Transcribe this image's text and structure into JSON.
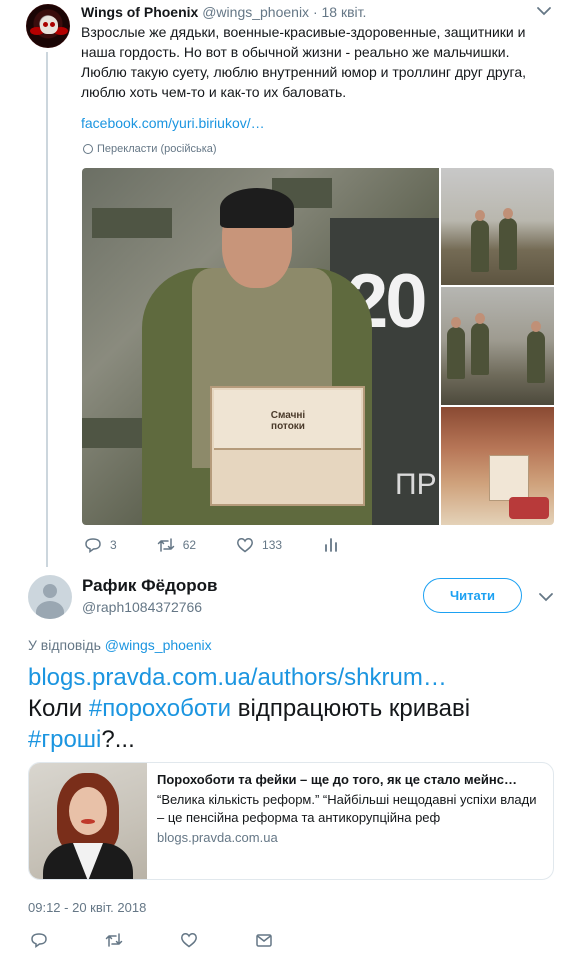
{
  "parent_tweet": {
    "author_name": "Wings of Phoenix",
    "author_handle": "@wings_phoenix",
    "separator": "·",
    "date": "18 квіт.",
    "text": "Взрослые же дядьки, военные-красивые-здоровенные, защитники и наша гордость. Но вот в обычной жизни - реально же мальчишки. Люблю такую суету, люблю внутренний юмор и троллинг друг друга, люблю хоть чем-то и как-то их баловать.",
    "link": "facebook.com/yuri.biriukov/…",
    "translate_label": "Перекласти (російська)",
    "media": {
      "banner_number": "20",
      "banner_letters": "ПР",
      "box_brand": "Смачні потоки"
    },
    "actions": {
      "reply_icon": "reply-icon",
      "reply_count": "3",
      "retweet_icon": "retweet-icon",
      "retweet_count": "62",
      "like_icon": "heart-icon",
      "like_count": "133",
      "analytics_icon": "analytics-icon"
    }
  },
  "focused_tweet": {
    "author_name": "Рафик Фёдоров",
    "author_handle": "@raph1084372766",
    "follow_label": "Читати",
    "reply_prefix": "У відповідь ",
    "reply_mention": "@wings_phoenix",
    "text_link": "blogs.pravda.com.ua/authors/shkrum…",
    "text_part1": "Коли ",
    "hashtag1": "#порохоботи",
    "text_part2": " відпрацюють криваві ",
    "hashtag2": "#гроші",
    "text_part3": "?...",
    "card": {
      "title": "Порохоботи та фейки – ще до того, як це стало мейнс…",
      "description": "“Велика кількість реформ.” “Найбільші нещодавні успіхи влади – це пенсійна реформа та антикорупційна реф",
      "domain": "blogs.pravda.com.ua"
    },
    "timestamp": "09:12 - 20 квіт. 2018",
    "actions": [
      "reply-icon",
      "retweet-icon",
      "heart-icon",
      "message-icon"
    ]
  },
  "colors": {
    "accent": "#1da1f2",
    "link": "#1b95e0",
    "muted": "#657786",
    "text": "#14171a",
    "border": "#e1e8ed"
  }
}
